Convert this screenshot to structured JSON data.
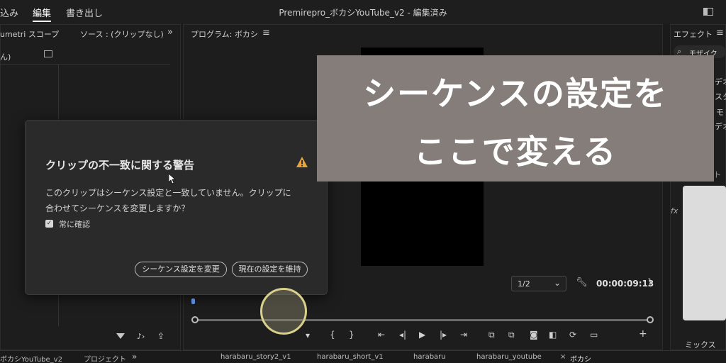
{
  "menubar": {
    "items": [
      "込み",
      "編集",
      "書き出し"
    ],
    "title": "Premirepro_ボカシYouTube_v2 - 編集済み"
  },
  "panels": {
    "lumetri_title": "umetri スコープ",
    "source_title": "ソース : (クリップなし)",
    "source_more": "»",
    "program_title": "プログラム: ボカシ",
    "program_menu": "≡",
    "left_sub": "ん)",
    "effects_title": "エフェクト",
    "effects_menu": "≡",
    "effects_search": "モザイク",
    "effects_items": [
      "デオ",
      "スタ",
      "モ",
      "デオ"
    ],
    "audio_title": "ーディオト",
    "mix_label": "ミックス"
  },
  "dialog": {
    "title": "クリップの不一致に関する警告",
    "message_line1": "このクリップはシーケンス設定と一致していません。クリップに",
    "message_line2": "合わせてシーケンスを変更しますか？",
    "checkbox_label": "常に確認",
    "change_button": "シーケンス設定を変更",
    "keep_button": "現在の設定を維持"
  },
  "overlay": {
    "line1": "シーケンスの設定を",
    "line2": "ここで変える"
  },
  "program_controls": {
    "zoom": "1/2",
    "timecode": "00:00:09:13"
  },
  "bottom_tabs": {
    "left": "ボカシYouTube_v2",
    "project": "プロジェクト",
    "more": "»",
    "t1": "harabaru_story2_v1",
    "t2": "harabaru_short_v1",
    "t3": "harabaru",
    "t4": "harabaru_youtube",
    "close": "×",
    "t5": "ボカシ"
  },
  "fx_labels": {
    "fx": "fx"
  }
}
